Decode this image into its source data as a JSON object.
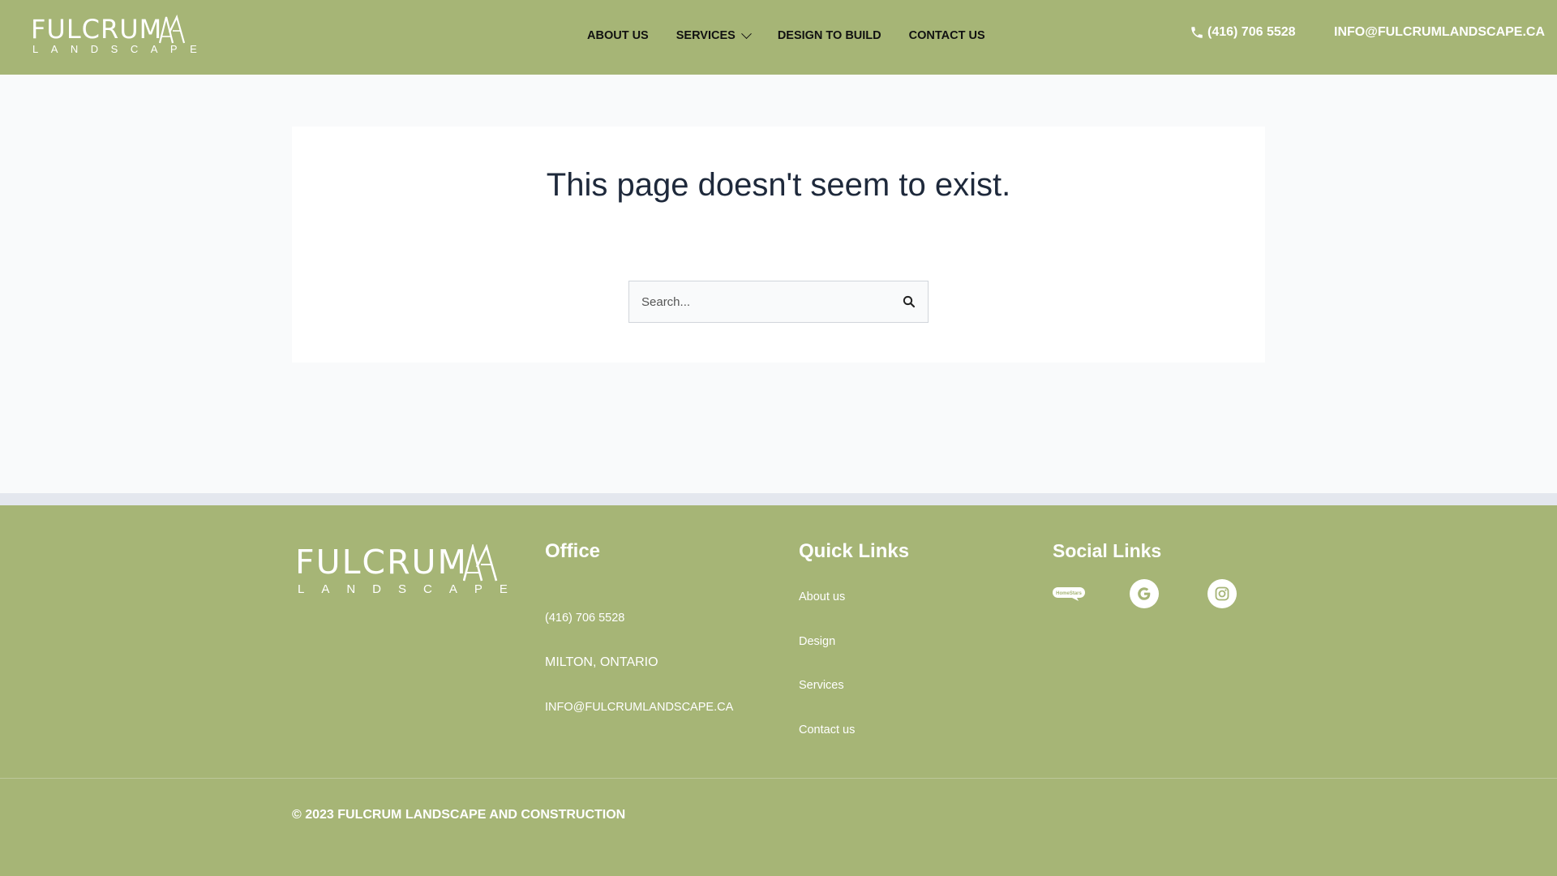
{
  "header": {
    "logo": {
      "word": "FULCRUM",
      "sub": "LANDSCAPE"
    },
    "nav": [
      {
        "label": "ABOUT US"
      },
      {
        "label": "SERVICES"
      },
      {
        "label": "DESIGN TO BUILD"
      },
      {
        "label": "CONTACT US"
      }
    ],
    "phone": "(416) 706 5528",
    "email": "INFO@FULCRUMLANDSCAPE.CA",
    "icons": {
      "phone": "phone-icon",
      "services_dropdown": "chevron-down-icon"
    }
  },
  "main": {
    "title": "This page doesn't seem to exist.",
    "search": {
      "placeholder": "Search...",
      "button_icon": "search-icon"
    }
  },
  "footer": {
    "logo": {
      "word": "FULCRUM",
      "sub": "LANDSCAPE"
    },
    "office": {
      "title": "Office",
      "phone": "(416) 706 5528",
      "location": "MILTON, ONTARIO",
      "email": "INFO@FULCRUMLANDSCAPE.CA"
    },
    "quick_links": {
      "title": "Quick Links",
      "items": [
        "About us",
        "Design",
        "Services",
        "Contact us"
      ]
    },
    "social": {
      "title": "Social Links",
      "items": [
        {
          "icon": "homestars-icon",
          "text": "HomeStars"
        },
        {
          "icon": "google-icon"
        },
        {
          "icon": "instagram-icon"
        }
      ]
    },
    "copyright": "© 2023 FULCRUM LANDSCAPE AND CONSTRUCTION"
  },
  "colors": {
    "brand_green": "#a6b576",
    "page_bg": "#f9fafb",
    "title_text": "#1e293b"
  }
}
